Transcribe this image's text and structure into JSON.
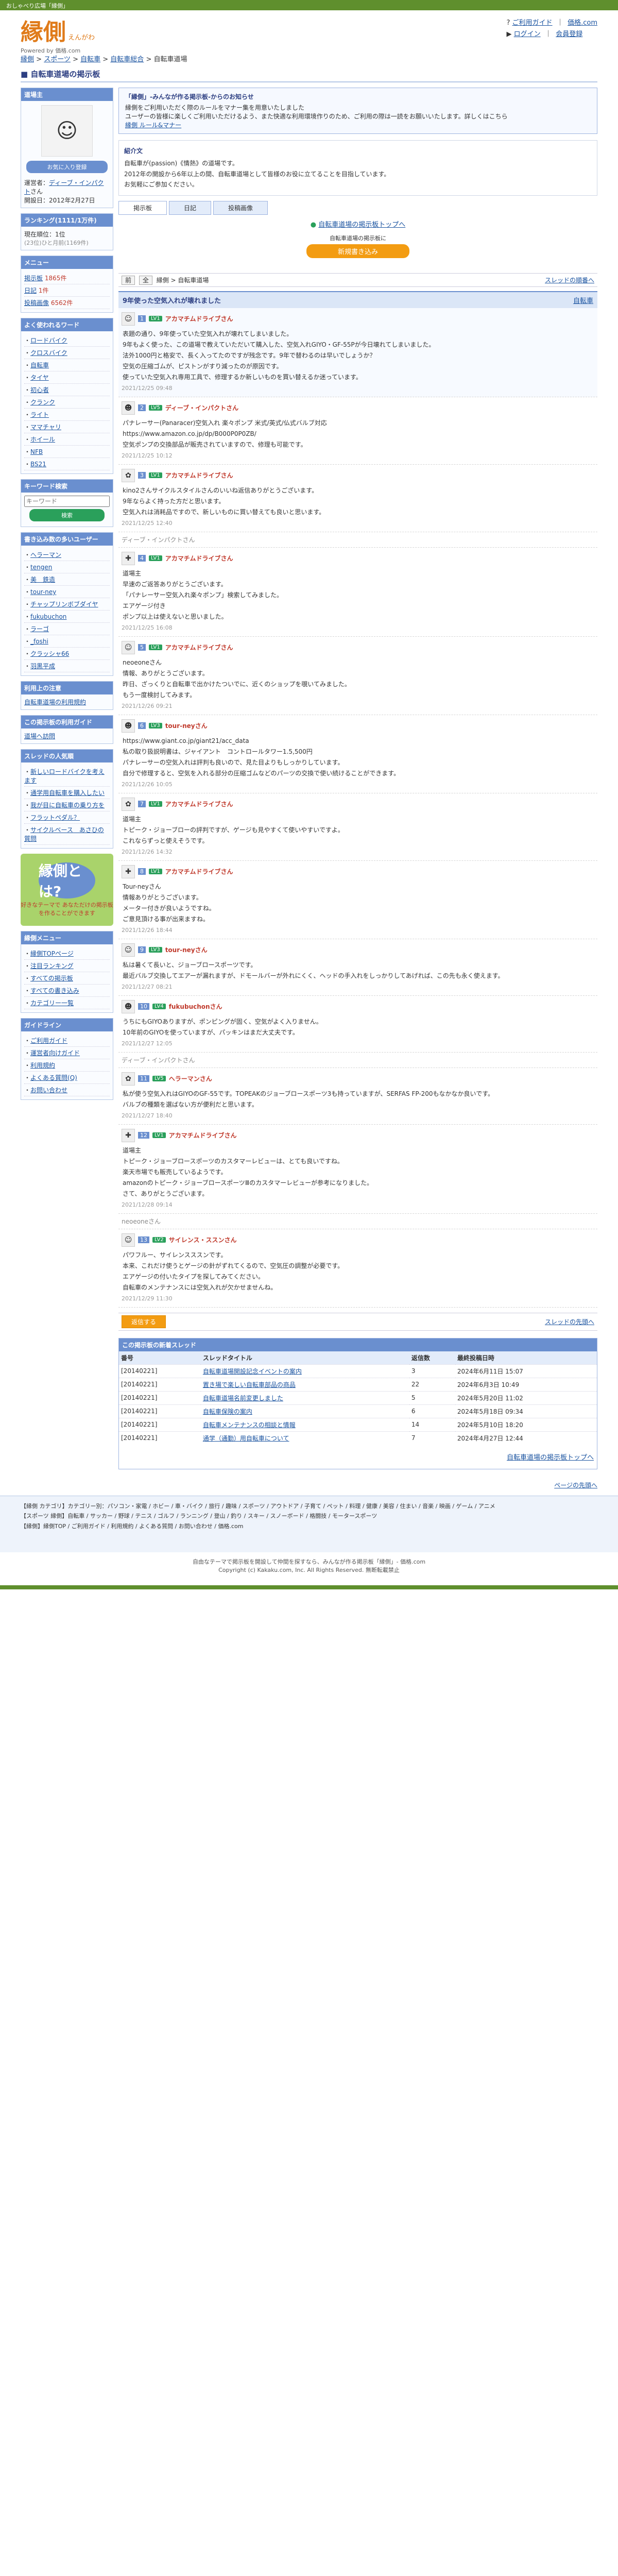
{
  "topstrip": "おしゃべり広場「縁側」",
  "logo": {
    "mark": "縁側",
    "reading": "えんがわ",
    "sub": "Powered by 価格.com"
  },
  "toplinks": {
    "guide": "ご利用ガイド",
    "kakaku": "価格.com",
    "login": "ログイン",
    "register": "会員登録"
  },
  "breadcrumb": [
    "縁側",
    "スポーツ",
    "自転車",
    "自転車総合",
    "自転車道場"
  ],
  "page_title": "自転車道場の掲示板",
  "side": {
    "owner_title": "道場主",
    "owner_label": "運営者",
    "owner_name": "ディーブ・インパクト",
    "owner_honor": "さん",
    "owner_add_button": "お気に入り登録",
    "opened_label": "開設日",
    "opened_date": "2012年2月27日",
    "rank_title": "ランキング(1111/1万件)",
    "rank_lines": [
      "現在順位：1位",
      "(23位)ひと月前(1169件)"
    ],
    "menu_title": "メニュー",
    "menu": [
      {
        "label": "掲示板",
        "count": "1865件"
      },
      {
        "label": "日記",
        "count": "1件"
      },
      {
        "label": "投稿画像",
        "count": "6562件"
      }
    ],
    "words_title": "よく使われるワード",
    "words": [
      "ロードバイク",
      "クロスバイク",
      "自転車",
      "タイヤ",
      "初心者",
      "クランク",
      "ライト",
      "ママチャリ",
      "ホイール",
      "NFB",
      "BS21"
    ],
    "search_title": "キーワード検索",
    "search_placeholder": "キーワード",
    "search_button": "検索",
    "frequent_title": "書き込み数の多いユーザー",
    "frequent": [
      "ヘラーマン",
      "tengen",
      "美　鉄造",
      "tour-ney",
      "チャップリンボブダイヤ",
      "fukubuchon",
      "ラーゴ",
      "_foshi",
      "クラッシャ66",
      "羽黒平成"
    ],
    "rules_title": "利用上の注意",
    "rules_link": "自転車道場の利用規約",
    "fav_title": "この掲示板の利用ガイド",
    "fav_link": "道場へ訪問",
    "threads_title": "スレッドの人気順",
    "threads": [
      "新しいロードバイクを考えます",
      "通学用自転車を購入したい",
      "我が目に自転車の乗り方を",
      "フラットペダル？",
      "サイクルベース　あさひの質問"
    ],
    "banner_big": "縁側とは?",
    "banner_small": "好きなテーマで あなただけの掲示板 を作ることができます",
    "other_menu_title": "縁側メニュー",
    "other_menu": [
      "縁側TOPページ",
      "注目ランキング",
      "すべての掲示板",
      "すべての書き込み",
      "カテゴリー一覧"
    ],
    "guide_title": "ガイドライン",
    "guide": [
      "ご利用ガイド",
      "運営者向けガイド",
      "利用規約",
      "よくある質問(Q)",
      "お問い合わせ"
    ]
  },
  "notice": {
    "title": "「縁側」-みんなが作る掲示板-からのお知らせ",
    "body": "縁側をご利用いただく際のルールをマナー集を用意いたしました\nユーザーの皆様に楽しくご利用いただけるよう、また快適な利用環境作りのため、ご利用の際は一読をお願いいたします。詳しくはこちら",
    "link": "縁側 ルール&マナー"
  },
  "intro": {
    "title": "紹介文",
    "lines": [
      "自転車が(passion)《情熱》の道場です。",
      "2012年の開設から6年以上の間、自転車道場として皆様のお役に立てることを目指しています。",
      "お気軽にご参加ください。"
    ]
  },
  "tabs": [
    "掲示板",
    "日記",
    "投稿画像"
  ],
  "toplink": "自転車道場の掲示板トップへ",
  "cta": {
    "title": "自転車道場の掲示板に",
    "button": "新規書き込み"
  },
  "toolbar": {
    "buttons": [
      "前",
      "全"
    ],
    "crumb": "縁側 > 自転車道場",
    "next": "スレッドの順番へ"
  },
  "thread": {
    "title": "9年使った空気入れが壊れました",
    "category": "自転車",
    "posts": [
      {
        "num": "1",
        "name": "アカマチムドライブさん",
        "level": "LV1",
        "body": "表題の通り、9年使っていた空気入れが壊れてしまいました。\n9年もよく使った、この道場で教えていただいて購入した、空気入れGIYO・GF-55Pが今日壊れてしまいました。\n法外1000円と格安で、長く入ってたのですが残念です。9年で替わるのは早いでしょうか？\n空気の圧縮ゴムが、ピストンがすり減ったのが原因です。\n使っていた空気入れ専用工具で、修理するか新しいものを買い替えるか迷っています。",
        "time": "2021/12/25 09:48"
      },
      {
        "num": "2",
        "name": "ディーブ・インパクトさん",
        "level": "LV5",
        "body": "パナレーサー(Panaracer)空気入れ 楽々ポンプ 米式/英式/仏式バルブ対応\nhttps://www.amazon.co.jp/dp/B000P0P0ZB/\n空気ポンプの交換部品が販売されていますので、修理も可能です。",
        "time": "2021/12/25 10:12"
      },
      {
        "num": "3",
        "name": "アカマチムドライブさん",
        "level": "LV1",
        "body": "kino2さんサイクルスタイルさんのいいね返信ありがとうございます。\n9年ならよく持った方だと思います。\n空気入れは消耗品ですので、新しいものに買い替えても良いと思います。",
        "time": "2021/12/25 12:40"
      },
      {
        "num": "4",
        "name": "アカマチムドライブさん",
        "level": "LV1",
        "body": "道場主\n早速のご返答ありがとうございます。\n「パナレーサー空気入れ楽々ポンプ」検索してみました。\nエアゲージ付き\nポンプ以上は使えないと思いました。",
        "time": "2021/12/25 16:08"
      },
      {
        "num": "5",
        "name": "アカマチムドライブさん",
        "level": "LV1",
        "body": "neoeoneさん\n情報、ありがとうございます。\n昨日、ざっくりと自転車で出かけたついでに、近くのショップを覗いてみました。\nもう一度検討してみます。",
        "time": "2021/12/26 09:21"
      },
      {
        "num": "6",
        "name": "tour-neyさん",
        "level": "LV3",
        "body": "https://www.giant.co.jp/giant21/acc_data\n私の取り扱説明書は、ジャイアント　コントロールタワー1.5,500円\nパナレーサーの空気入れは評判も良いので、見た目よりもしっかりしています。\n自分で修理すると、空気を入れる部分の圧縮ゴムなどのパーツの交換で使い続けることができます。",
        "time": "2021/12/26 10:05"
      },
      {
        "num": "7",
        "name": "アカマチムドライブさん",
        "level": "LV1",
        "body": "道場主\nトピーク・ジョーブローの評判ですが、ゲージも見やすくて使いやすいですよ。\nこれならずっと使えそうです。",
        "time": "2021/12/26 14:32"
      },
      {
        "num": "8",
        "name": "アカマチムドライブさん",
        "level": "LV1",
        "body": "Tour-neyさん\n情報ありがとうございます。\nメーター付きが良いようですね。\nご意見頂ける事が出来ますね。",
        "time": "2021/12/26 18:44"
      },
      {
        "num": "9",
        "name": "tour-neyさん",
        "level": "LV3",
        "body": "私は暑くて長いと、ジョーブロースポーツです。\n最近バルブ交換してエアーが漏れますが、ドモールバーが外れにくく、ヘッドの手入れをしっかりしてあげれば、この先も永く使えます。",
        "time": "2021/12/27 08:21"
      },
      {
        "num": "10",
        "name": "fukubuchonさん",
        "level": "LV4",
        "body": "うちにもGIYOありますが、ポンピングが固く、空気がよく入りません。\n10年前のGIYOを使っていますが、パッキンはまだ大丈夫です。",
        "time": "2021/12/27 12:05"
      },
      {
        "num": "11",
        "name": "ヘラーマンさん",
        "level": "LV5",
        "body": "私が使う空気入れはGIYOのGF-55です。TOPEAKのジョーブロースポーツ3も持っていますが、SERFAS FP-200もなかなか良いです。\nバルブの種類を選ばない方が便利だと思います。",
        "time": "2021/12/27 18:40"
      },
      {
        "num": "12",
        "name": "アカマチムドライブさん",
        "level": "LV1",
        "body": "道場主\nトピーク・ジョーブロースポーツのカスタマーレビューは、とても良いですね。\n楽天市場でも販売しているようです。\namazonのトピーク・ジョーブロースポーツⅢのカスタマーレビューが参考になりました。\nさて、ありがとうございます。",
        "time": "2021/12/28 09:14"
      },
      {
        "num": "13",
        "name": "サイレンス・ススンさん",
        "level": "LV2",
        "body": "パワフルー、サイレンスススンです。\n本来、これだけ使うとゲージの針がずれてくるので、空気圧の調整が必要です。\nエアゲージの付いたタイプを探してみてください。\n自転車のメンテナンスには空気入れが欠かせませんね。",
        "time": "2021/12/29 11:30"
      }
    ],
    "deleted_posts": [
      "neoeoneさん",
      "kino2さん",
      "ディーブ・インパクトさん",
      "tour-neyさん",
      "neoeoneさん",
      "kino2さん",
      "ディーブ・インパクトさん"
    ]
  },
  "bottom_cta": "返信する",
  "bottom_next": "スレッドの先頭へ",
  "related": {
    "title": "この掲示板の新着スレッド",
    "headers": [
      "番号",
      "スレッドタイトル",
      "返信数",
      "最終投稿日時"
    ],
    "rows": [
      {
        "no": "[20140221]",
        "title": "自転車道場開設記念イベントの案内",
        "replies": "3",
        "date": "2024年6月11日 15:07"
      },
      {
        "no": "[20140221]",
        "title": "置き場で楽しい自転車部品の商品",
        "replies": "22",
        "date": "2024年6月3日 10:49"
      },
      {
        "no": "[20140221]",
        "title": "自転車道場名前変更しました",
        "replies": "5",
        "date": "2024年5月20日 11:02"
      },
      {
        "no": "[20140221]",
        "title": "自転車保険の案内",
        "replies": "6",
        "date": "2024年5月18日 09:34"
      },
      {
        "no": "[20140221]",
        "title": "自転車メンテナンスの相談と情報",
        "replies": "14",
        "date": "2024年5月10日 18:20"
      },
      {
        "no": "[20140221]",
        "title": "通学（通勤）用自転車について",
        "replies": "7",
        "date": "2024年4月27日 12:44"
      }
    ],
    "toplink": "自転車道場の掲示板トップへ"
  },
  "page_top": "ページの先頭へ",
  "footer": {
    "lines": [
      "【縁側 カテゴリ】カテゴリー別：パソコン・家電 / ホビー / 車・バイク / 旅行 / 趣味 / スポーツ / アウトドア / 子育て / ペット / 料理 / 健康 / 美容 / 住まい / 音楽 / 映画 / ゲーム / アニメ",
      "【スポーツ 縁側】自転車 / サッカー / 野球 / テニス / ゴルフ / ランニング / 登山 / 釣り / スキー / スノーボード / 格闘技 / モータースポーツ",
      "【縁側】縁側TOP / ご利用ガイド / 利用規約 / よくある質問 / お問い合わせ / 価格.com"
    ]
  },
  "copyright": [
    "自由なテーマで掲示板を開設して仲間を探すなら、みんなが作る掲示板「縁側」- 価格.com",
    "Copyright (c) Kakaku.com, Inc. All Rights Reserved. 無断転載禁止"
  ],
  "colors": {
    "brand": "#5f8f2d",
    "accent": "#e07b1a",
    "link": "#1a53a0",
    "header": "#6a8fcf"
  }
}
